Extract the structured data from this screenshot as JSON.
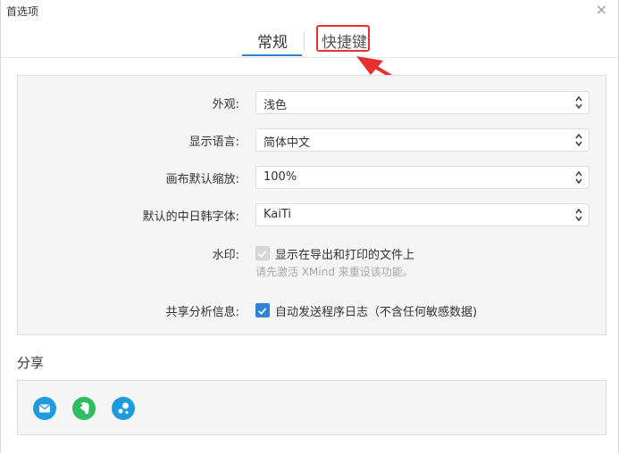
{
  "window": {
    "title": "首选项",
    "close_glyph": "×"
  },
  "tabs": [
    {
      "label": "常规",
      "active": true
    },
    {
      "label": "快捷键",
      "active": false
    }
  ],
  "settings": {
    "appearance": {
      "label": "外观:",
      "value": "浅色"
    },
    "language": {
      "label": "显示语言:",
      "value": "简体中文"
    },
    "zoom": {
      "label": "画布默认缩放:",
      "value": "100%"
    },
    "cjk_font": {
      "label": "默认的中日韩字体:",
      "value": "KaiTi"
    },
    "watermark": {
      "label": "水印:",
      "checkbox_label": "显示在导出和打印的文件上",
      "hint": "请先激活 XMind 来重设该功能。",
      "checked": true,
      "disabled": true
    },
    "analytics": {
      "label": "共享分析信息:",
      "checkbox_label": "自动发送程序日志（不含任何敏感数据)",
      "checked": true
    }
  },
  "share": {
    "title": "分享",
    "buttons": [
      {
        "name": "email",
        "icon": "mail-icon",
        "color": "#1e9be0"
      },
      {
        "name": "evernote",
        "icon": "evernote-icon",
        "color": "#2dbe60"
      },
      {
        "name": "biggerplate",
        "icon": "biggerplate-icon",
        "color": "#1e9be0"
      }
    ]
  },
  "colors": {
    "accent": "#2d84d6",
    "highlight_annotation": "#e8302e"
  }
}
